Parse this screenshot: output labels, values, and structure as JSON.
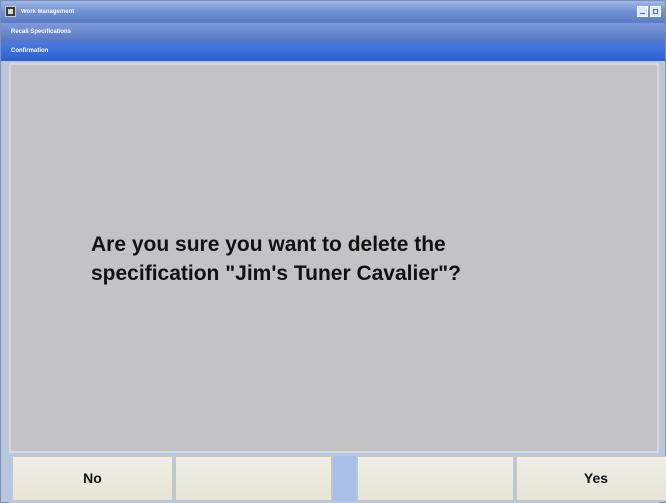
{
  "window": {
    "title": "Work Management",
    "section": "Recall Specifications",
    "dialog_title": "Confirmation"
  },
  "dialog": {
    "message": "Are you sure you want to delete the\nspecification \"Jim's Tuner Cavalier\"?"
  },
  "buttons": {
    "f1": "No",
    "f2": "",
    "f3": "",
    "f4": "Yes"
  }
}
